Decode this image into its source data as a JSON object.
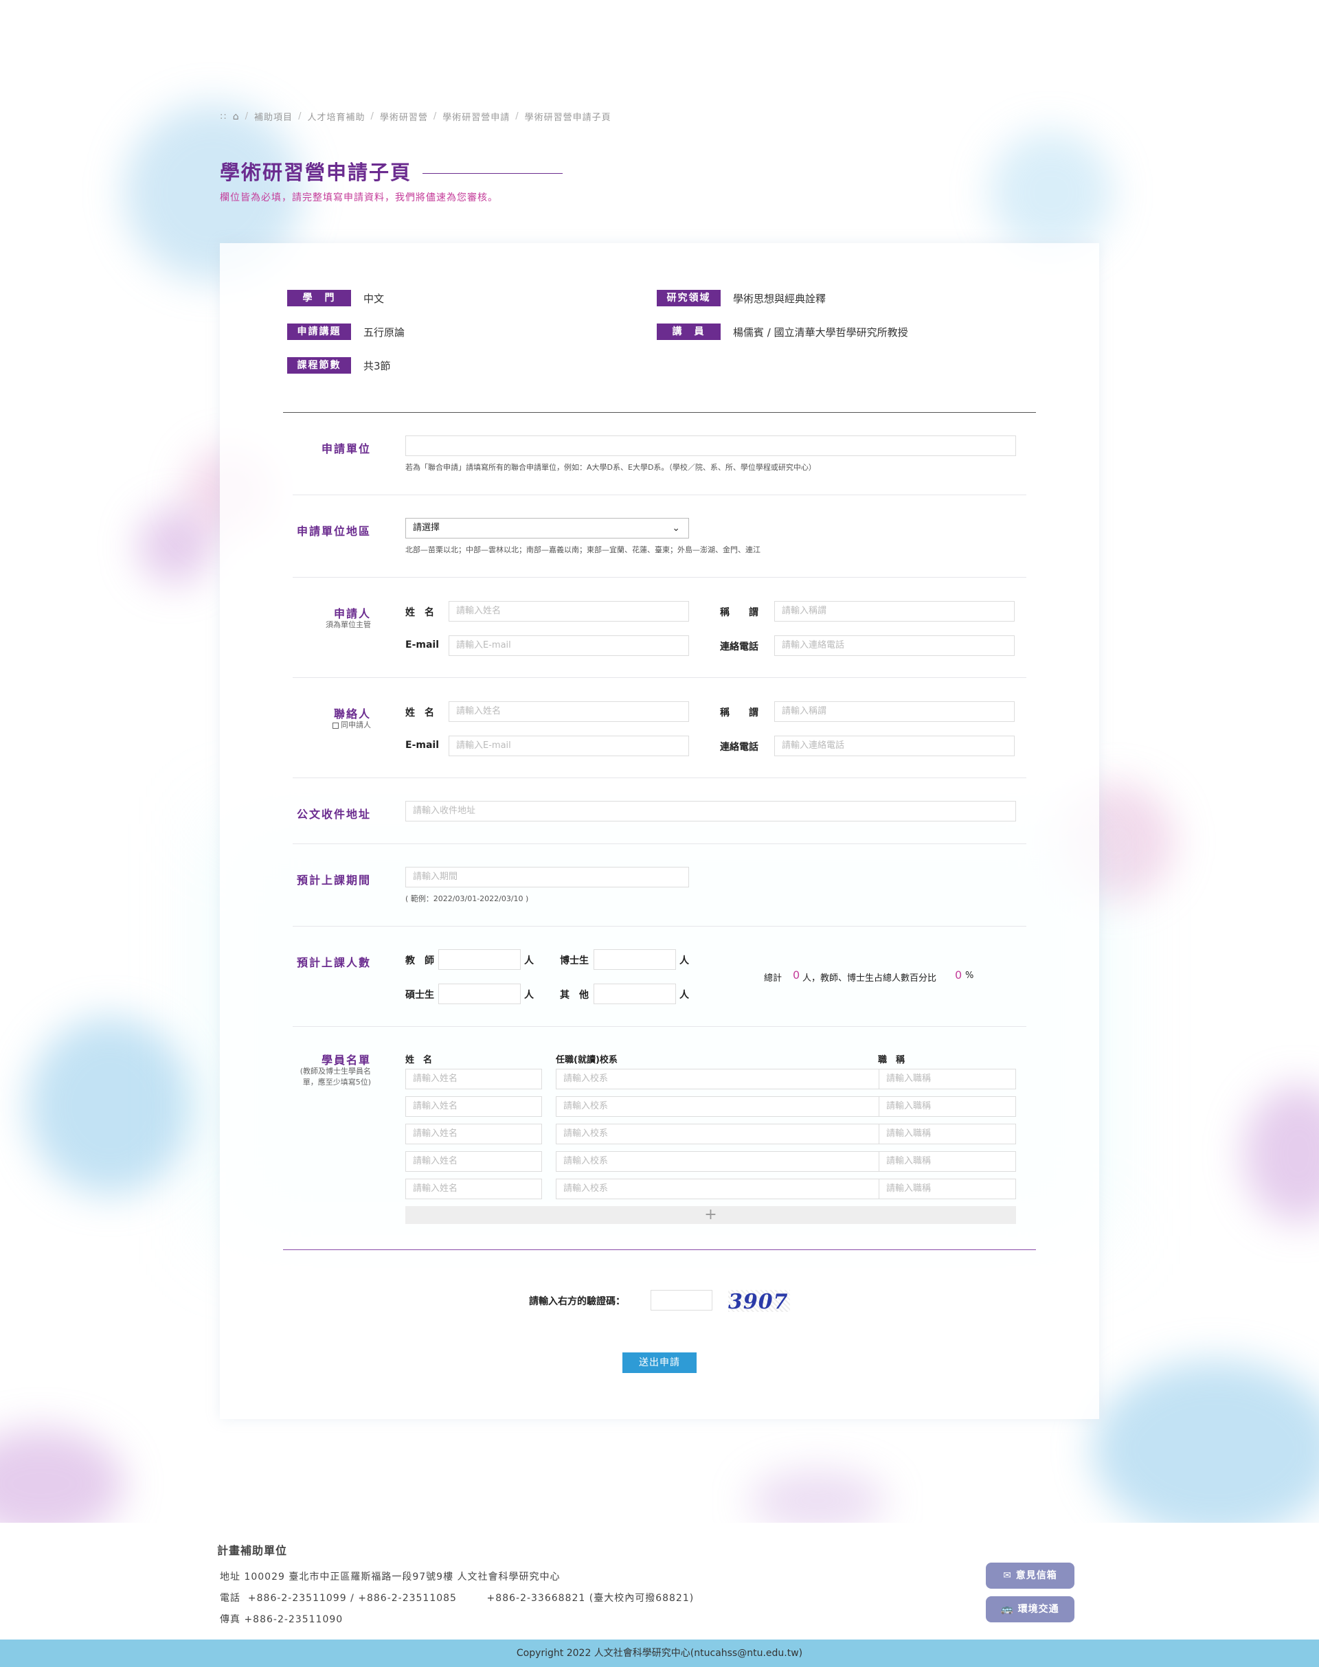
{
  "breadcrumb": [
    "補助項目",
    "人才培育補助",
    "學術研習營",
    "學術研習營申請",
    "學術研習營申請子頁"
  ],
  "page": {
    "title": "學術研習營申請子頁",
    "subtitle": "欄位皆為必填，請完整填寫申請資料，我們將儘速為您審核。"
  },
  "info": {
    "dept_tag": "學　門",
    "dept_value": "中文",
    "field_tag": "研究領域",
    "field_value": "學術思想與經典詮釋",
    "topic_tag": "申請講題",
    "topic_value": "五行原論",
    "lecturer_tag": "講　員",
    "lecturer_value": "楊儒賓 / 國立清華大學哲學研究所教授",
    "sessions_tag": "課程節數",
    "sessions_value": "共3節"
  },
  "form": {
    "unit": {
      "label": "申請單位",
      "note": "若為「聯合申請」請填寫所有的聯合申請單位，例如：A大學D系、E大學D系。（學校／院、系、所、學位學程或研究中心）"
    },
    "region": {
      "label": "申請單位地區",
      "selected": "請選擇",
      "note": "北部—苗栗以北；中部—雲林以北；南部—嘉義以南；東部—宜蘭、花蓮、臺東；外島—澎湖、金門、連江"
    },
    "applicant": {
      "label": "申請人",
      "note": "須為單位主管",
      "name_label": "姓　名",
      "name_ph": "請輸入姓名",
      "title_label": "稱　　謂",
      "title_ph": "請輸入稱謂",
      "email_label": "E-mail",
      "email_ph": "請輸入E-mail",
      "phone_label": "連絡電話",
      "phone_ph": "請輸入連絡電話"
    },
    "contact": {
      "label": "聯絡人",
      "same_label": "同申請人",
      "name_label": "姓　名",
      "name_ph": "請輸入姓名",
      "title_label": "稱　　謂",
      "title_ph": "請輸入稱謂",
      "email_label": "E-mail",
      "email_ph": "請輸入E-mail",
      "phone_label": "連絡電話",
      "phone_ph": "請輸入連絡電話"
    },
    "address": {
      "label": "公文收件地址",
      "ph": "請輸入收件地址"
    },
    "period": {
      "label": "預計上課期間",
      "ph": "請輸入期間",
      "note": "( 範例：2022/03/01-2022/03/10 )"
    },
    "count": {
      "label": "預計上課人數",
      "teacher": "教　師",
      "phd": "博士生",
      "master": "碩士生",
      "other": "其　他",
      "unit": "人",
      "total_prefix": "總計",
      "total_value": "0",
      "total_suffix": "人，教師、博士生占總人數百分比",
      "percent_value": "0",
      "percent_unit": "%"
    },
    "roster": {
      "label": "學員名單",
      "note": "(教師及博士生學員名單，應至少填寫5位)",
      "col_name": "姓　名",
      "col_school": "任職(就讀)校系",
      "col_title": "職　稱",
      "name_ph": "請輸入姓名",
      "school_ph": "請輸入校系",
      "title_ph": "請輸入職稱",
      "add": "+"
    },
    "captcha": {
      "label": "請輸入右方的驗證碼：",
      "code": "3907"
    },
    "submit": "送出申請"
  },
  "footer": {
    "title": "計畫補助單位",
    "address": "地址  100029 臺北市中正區羅斯福路一段97號9樓 人文社會科學研究中心",
    "phone": "電話  +886-2-23511099 / +886-2-23511085        +886-2-33668821 (臺大校內可撥68821)",
    "fax": "傳真  +886-2-23511090",
    "feedback_btn": "意見信箱",
    "transport_btn": "環境交通",
    "copyright": "Copyright 2022 人文社會科學研究中心(ntucahss@ntu.edu.tw)"
  },
  "colors": {
    "primary": "#6b2c8f",
    "accent": "#c43d9a",
    "button": "#2e9bd6",
    "footer_bar": "#88cbe6"
  }
}
